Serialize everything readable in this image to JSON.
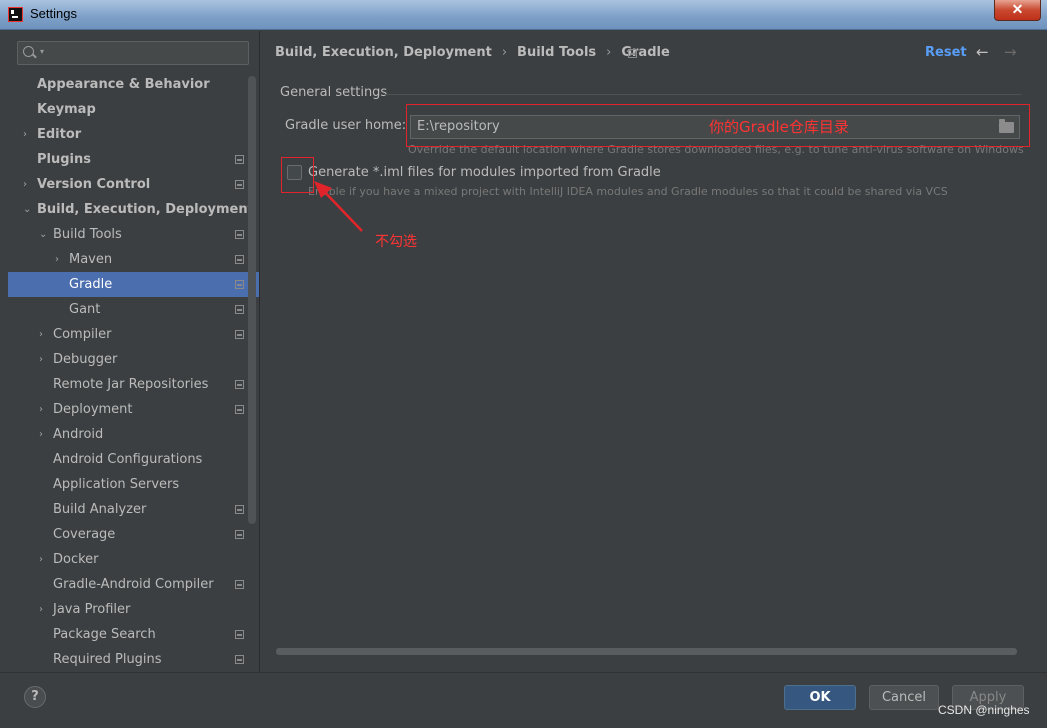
{
  "window": {
    "title": "Settings",
    "close_glyph": "✕"
  },
  "search": {
    "placeholder": ""
  },
  "sidebar": {
    "items": [
      {
        "label": "Appearance & Behavior",
        "level": 0,
        "arrow": "",
        "bold": true,
        "proj": false,
        "selected": false
      },
      {
        "label": "Keymap",
        "level": 0,
        "arrow": "",
        "bold": true,
        "proj": false,
        "selected": false
      },
      {
        "label": "Editor",
        "level": 0,
        "arrow": "›",
        "bold": true,
        "proj": false,
        "selected": false
      },
      {
        "label": "Plugins",
        "level": 0,
        "arrow": "",
        "bold": true,
        "proj": true,
        "selected": false
      },
      {
        "label": "Version Control",
        "level": 0,
        "arrow": "›",
        "bold": true,
        "proj": true,
        "selected": false
      },
      {
        "label": "Build, Execution, Deployment",
        "level": 0,
        "arrow": "⌄",
        "bold": true,
        "proj": false,
        "selected": false
      },
      {
        "label": "Build Tools",
        "level": 1,
        "arrow": "⌄",
        "bold": false,
        "proj": true,
        "selected": false
      },
      {
        "label": "Maven",
        "level": 2,
        "arrow": "›",
        "bold": false,
        "proj": true,
        "selected": false
      },
      {
        "label": "Gradle",
        "level": 2,
        "arrow": "",
        "bold": false,
        "proj": true,
        "selected": true
      },
      {
        "label": "Gant",
        "level": 2,
        "arrow": "",
        "bold": false,
        "proj": true,
        "selected": false
      },
      {
        "label": "Compiler",
        "level": 1,
        "arrow": "›",
        "bold": false,
        "proj": true,
        "selected": false
      },
      {
        "label": "Debugger",
        "level": 1,
        "arrow": "›",
        "bold": false,
        "proj": false,
        "selected": false
      },
      {
        "label": "Remote Jar Repositories",
        "level": 1,
        "arrow": "",
        "bold": false,
        "proj": true,
        "selected": false
      },
      {
        "label": "Deployment",
        "level": 1,
        "arrow": "›",
        "bold": false,
        "proj": true,
        "selected": false
      },
      {
        "label": "Android",
        "level": 1,
        "arrow": "›",
        "bold": false,
        "proj": false,
        "selected": false
      },
      {
        "label": "Android Configurations",
        "level": 1,
        "arrow": "",
        "bold": false,
        "proj": false,
        "selected": false
      },
      {
        "label": "Application Servers",
        "level": 1,
        "arrow": "",
        "bold": false,
        "proj": false,
        "selected": false
      },
      {
        "label": "Build Analyzer",
        "level": 1,
        "arrow": "",
        "bold": false,
        "proj": true,
        "selected": false
      },
      {
        "label": "Coverage",
        "level": 1,
        "arrow": "",
        "bold": false,
        "proj": true,
        "selected": false
      },
      {
        "label": "Docker",
        "level": 1,
        "arrow": "›",
        "bold": false,
        "proj": false,
        "selected": false
      },
      {
        "label": "Gradle-Android Compiler",
        "level": 1,
        "arrow": "",
        "bold": false,
        "proj": true,
        "selected": false
      },
      {
        "label": "Java Profiler",
        "level": 1,
        "arrow": "›",
        "bold": false,
        "proj": false,
        "selected": false
      },
      {
        "label": "Package Search",
        "level": 1,
        "arrow": "",
        "bold": false,
        "proj": true,
        "selected": false
      },
      {
        "label": "Required Plugins",
        "level": 1,
        "arrow": "",
        "bold": false,
        "proj": true,
        "selected": false
      }
    ]
  },
  "breadcrumb": {
    "items": [
      "Build, Execution, Deployment",
      "Build Tools",
      "Gradle"
    ],
    "separator": "›"
  },
  "header": {
    "reset_label": "Reset",
    "back_glyph": "←",
    "forward_glyph": "→"
  },
  "general": {
    "section_title": "General settings",
    "user_home_label": "Gradle user home:",
    "user_home_value": "E:\\repository",
    "user_home_hint": "Override the default location where Gradle stores downloaded files, e.g. to tune anti-virus software on Windows",
    "iml_checkbox_label": "Generate *.iml files for modules imported from Gradle",
    "iml_checkbox_checked": false,
    "iml_hint": "Enable if you have a mixed project with IntelliJ IDEA modules and Gradle modules so that it could be shared via VCS"
  },
  "annotations": {
    "repo_note": "你的Gradle仓库目录",
    "checkbox_note": "不勾选",
    "color": "#e0242a"
  },
  "footer": {
    "help_label": "?",
    "ok_label": "OK",
    "cancel_label": "Cancel",
    "apply_label": "Apply"
  },
  "watermark": "CSDN @ninghes",
  "colors": {
    "selection": "#4b6eaf",
    "link": "#589df6",
    "ok_button": "#365880"
  }
}
